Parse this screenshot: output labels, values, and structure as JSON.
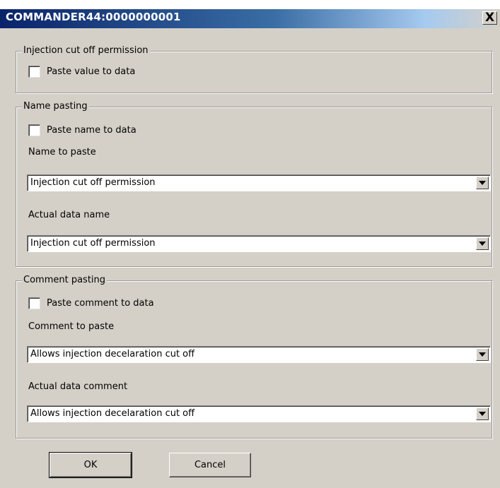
{
  "window": {
    "title": "COMMANDER44:0000000001",
    "close_glyph": "X"
  },
  "injection": {
    "legend": "Injection cut off permission",
    "paste_value_label": "Paste value to data",
    "paste_value_checked": false
  },
  "name_pasting": {
    "legend": "Name pasting",
    "paste_name_label": "Paste name to data",
    "paste_name_checked": false,
    "name_to_paste_label": "Name to paste",
    "name_to_paste_value": "Injection cut off permission",
    "actual_name_label": "Actual data name",
    "actual_name_value": "Injection cut off permission"
  },
  "comment_pasting": {
    "legend": "Comment pasting",
    "paste_comment_label": "Paste comment to data",
    "paste_comment_checked": false,
    "comment_to_paste_label": "Comment to paste",
    "comment_to_paste_value": "Allows injection decelaration cut off",
    "actual_comment_label": "Actual data comment",
    "actual_comment_value": "Allows injection decelaration cut off"
  },
  "buttons": {
    "ok": "OK",
    "cancel": "Cancel"
  },
  "colors": {
    "title_gradient_start": "#0a246a",
    "dialog_face": "#d4d0c8"
  }
}
